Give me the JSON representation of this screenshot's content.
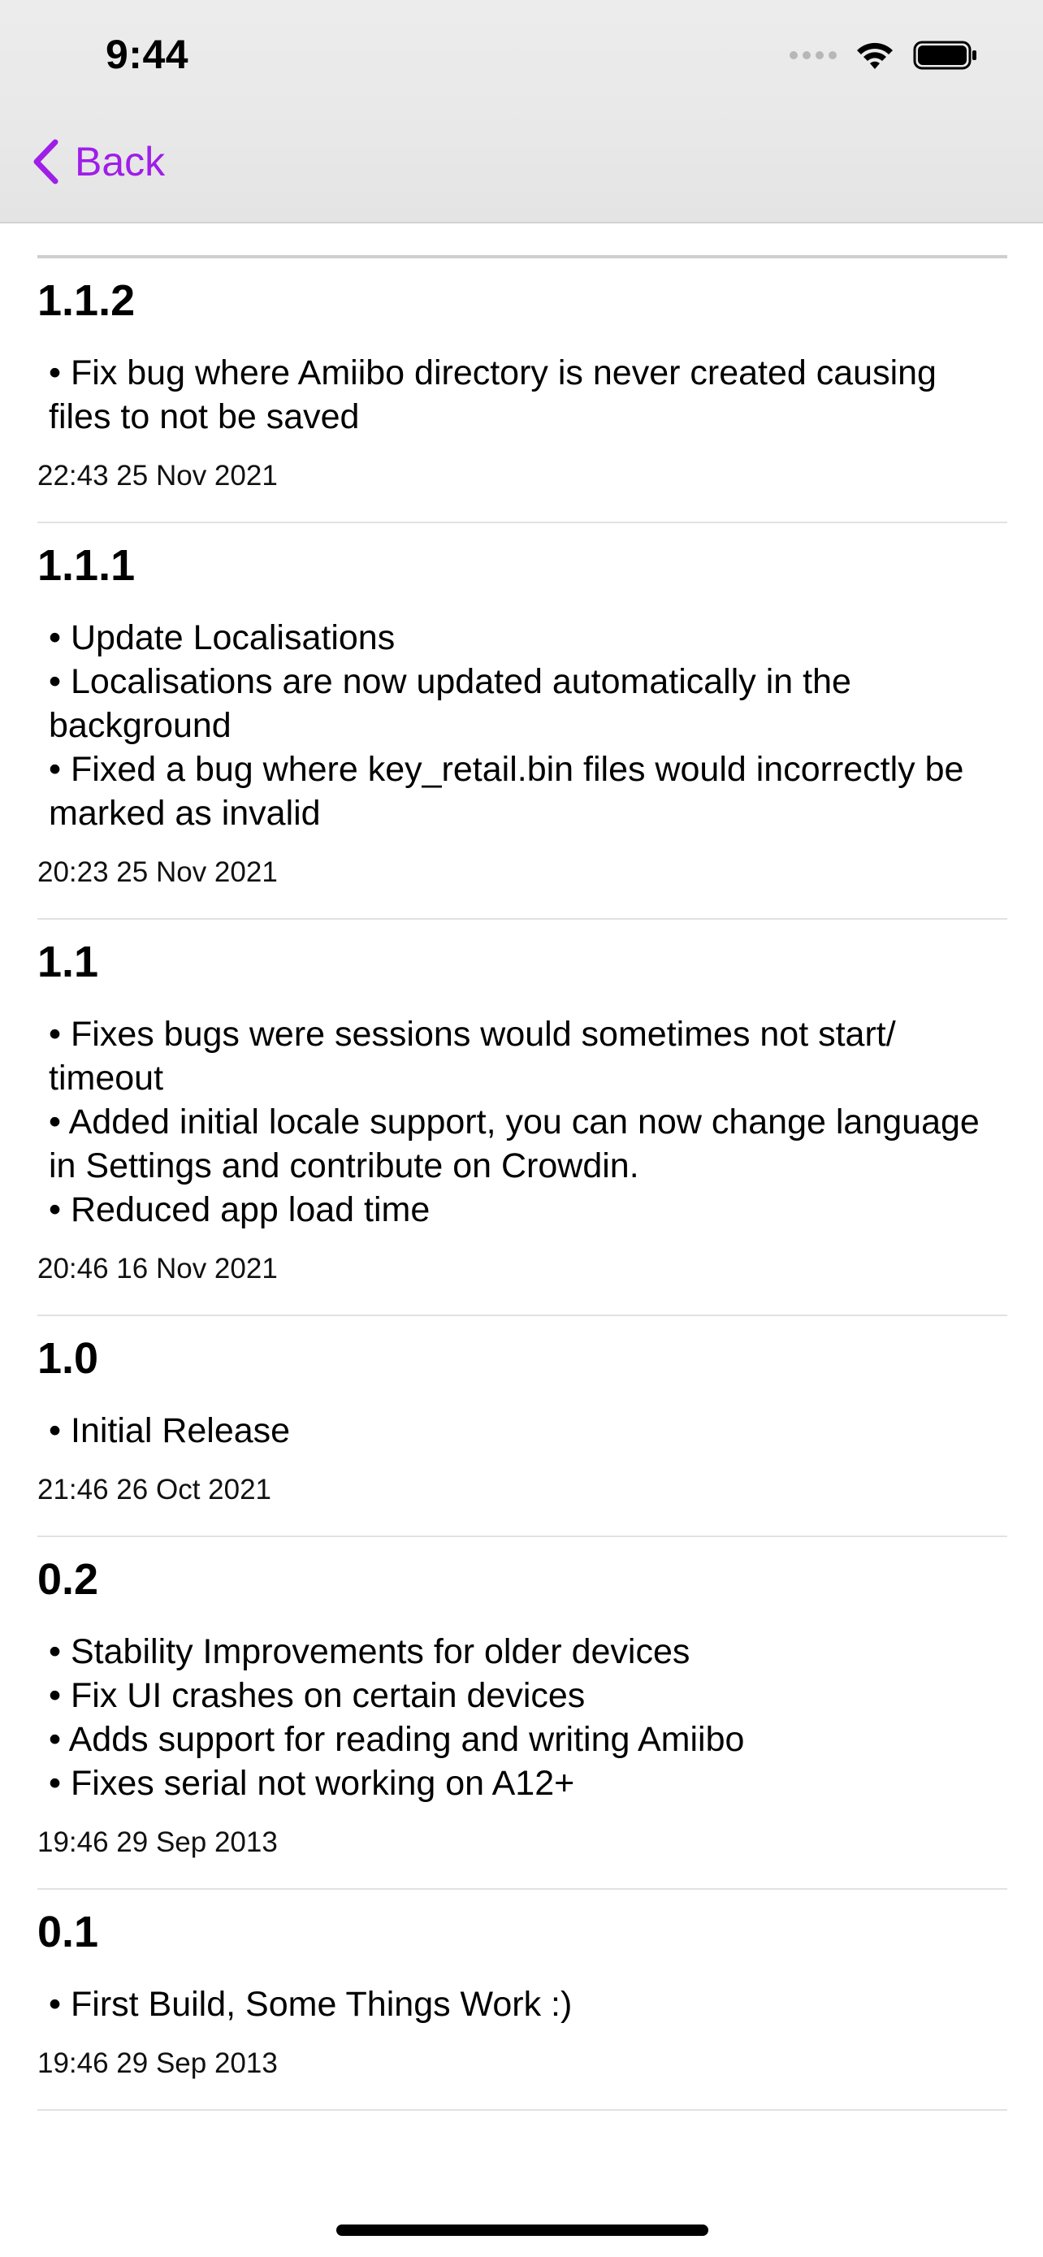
{
  "status_bar": {
    "time": "9:44"
  },
  "nav": {
    "back_label": "Back"
  },
  "entries": [
    {
      "version": "1.1.2",
      "notes": [
        "• Fix bug where Amiibo directory is never created causing files to not be saved"
      ],
      "date": "22:43 25 Nov 2021"
    },
    {
      "version": "1.1.1",
      "notes": [
        "• Update Localisations",
        "• Localisations are now updated automatically in the background",
        "• Fixed a bug where key_retail.bin files would incorrectly be marked as invalid"
      ],
      "date": "20:23 25 Nov 2021"
    },
    {
      "version": "1.1",
      "notes": [
        "• Fixes bugs were sessions would sometimes not start/ timeout",
        "• Added initial locale support, you can now change language in Settings and contribute on Crowdin.",
        "• Reduced app load time"
      ],
      "date": "20:46 16 Nov 2021"
    },
    {
      "version": "1.0",
      "notes": [
        "• Initial Release"
      ],
      "date": "21:46 26 Oct 2021"
    },
    {
      "version": "0.2",
      "notes": [
        "• Stability Improvements for older devices",
        "• Fix UI crashes on certain devices",
        "• Adds support for reading and writing Amiibo",
        "• Fixes serial not working on A12+"
      ],
      "date": "19:46 29 Sep 2013"
    },
    {
      "version": "0.1",
      "notes": [
        "• First Build, Some Things Work :)"
      ],
      "date": "19:46 29 Sep 2013"
    }
  ],
  "colors": {
    "accent": "#9f1ee8",
    "separator": "#e2e2e2"
  }
}
